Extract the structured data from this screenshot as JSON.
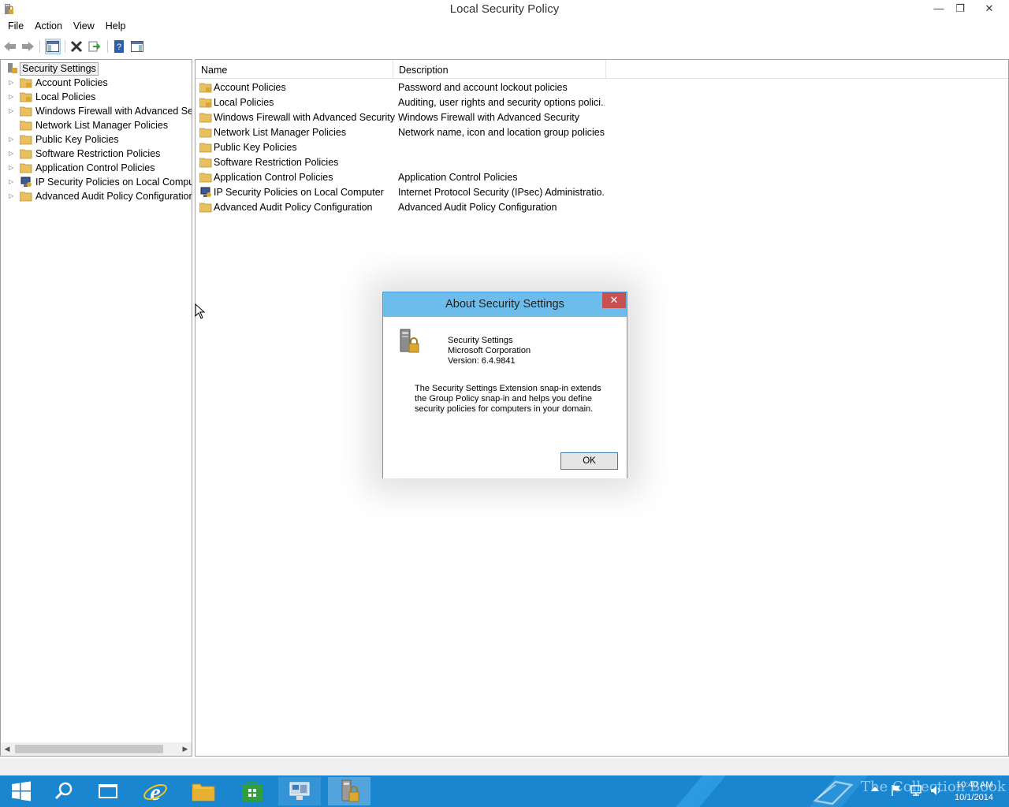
{
  "window": {
    "title": "Local Security Policy",
    "min_glyph": "—",
    "max_glyph": "❐",
    "close_glyph": "✕"
  },
  "menu": [
    "File",
    "Action",
    "View",
    "Help"
  ],
  "toolbar": {
    "buttons": [
      "back-arrow-icon",
      "forward-arrow-icon",
      "show-hide-tree-icon",
      "delete-icon",
      "export-list-icon",
      "help-icon",
      "properties-pane-icon"
    ]
  },
  "tree": {
    "root": "Security Settings",
    "items": [
      {
        "label": "Account Policies",
        "icon": "lock-folder"
      },
      {
        "label": "Local Policies",
        "icon": "lock-folder"
      },
      {
        "label": "Windows Firewall with Advanced Security",
        "icon": "folder"
      },
      {
        "label": "Network List Manager Policies",
        "icon": "folder"
      },
      {
        "label": "Public Key Policies",
        "icon": "folder"
      },
      {
        "label": "Software Restriction Policies",
        "icon": "folder"
      },
      {
        "label": "Application Control Policies",
        "icon": "folder"
      },
      {
        "label": "IP Security Policies on Local Computer",
        "icon": "ipsec"
      },
      {
        "label": "Advanced Audit Policy Configuration",
        "icon": "folder"
      }
    ]
  },
  "list": {
    "columns": [
      "Name",
      "Description"
    ],
    "rows": [
      {
        "name": "Account Policies",
        "desc": "Password and account lockout policies",
        "icon": "lock-folder"
      },
      {
        "name": "Local Policies",
        "desc": "Auditing, user rights and security options polici...",
        "icon": "lock-folder"
      },
      {
        "name": "Windows Firewall with Advanced Security",
        "desc": "Windows Firewall with Advanced Security",
        "icon": "folder"
      },
      {
        "name": "Network List Manager Policies",
        "desc": "Network name, icon and location group policies.",
        "icon": "folder"
      },
      {
        "name": "Public Key Policies",
        "desc": "",
        "icon": "folder"
      },
      {
        "name": "Software Restriction Policies",
        "desc": "",
        "icon": "folder"
      },
      {
        "name": "Application Control Policies",
        "desc": "Application Control Policies",
        "icon": "folder"
      },
      {
        "name": "IP Security Policies on Local Computer",
        "desc": "Internet Protocol Security (IPsec) Administratio...",
        "icon": "ipsec"
      },
      {
        "name": "Advanced Audit Policy Configuration",
        "desc": "Advanced Audit Policy Configuration",
        "icon": "folder"
      }
    ]
  },
  "dialog": {
    "title": "About Security Settings",
    "close_glyph": "✕",
    "product": "Security Settings",
    "company": "Microsoft Corporation",
    "version": "Version: 6.4.9841",
    "description": "The Security Settings Extension snap-in extends the Group Policy snap-in and helps you define security policies for computers in your domain.",
    "ok_label": "OK"
  },
  "taskbar": {
    "icons": [
      "start-icon",
      "search-icon",
      "task-view-icon",
      "internet-explorer-icon",
      "file-explorer-icon",
      "store-icon",
      "server-manager-icon",
      "local-security-policy-icon"
    ],
    "time": "10:40 AM",
    "date": "10/1/2014",
    "watermark": "The Collection Book"
  },
  "colors": {
    "taskbar": "#1a86d0",
    "dialog_title": "#6dbdec",
    "close_red": "#c75050",
    "folder": "#e8c060"
  }
}
